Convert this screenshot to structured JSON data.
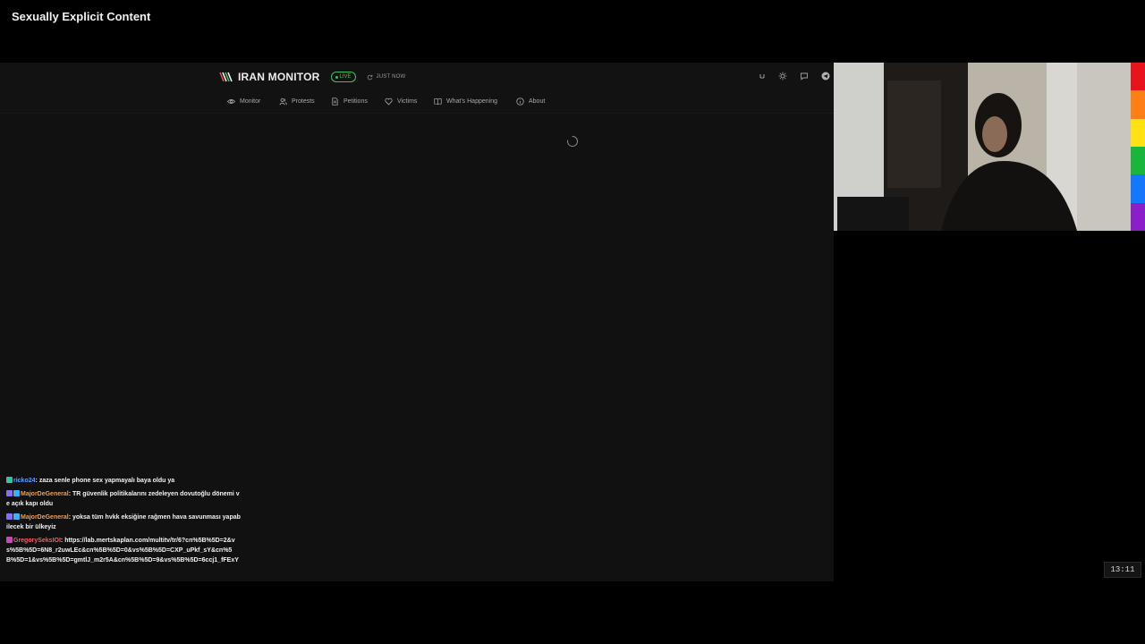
{
  "overlay": {
    "label": "Sexually Explicit Content"
  },
  "header": {
    "brand": "IRAN MONITOR",
    "live_badge": "LIVE",
    "update_status": "JUST NOW",
    "icons": [
      {
        "name": "language-toggle-icon",
        "glyph": "ı"
      },
      {
        "name": "theme-toggle-icon",
        "glyph": "sun"
      },
      {
        "name": "chat-icon",
        "glyph": "chat"
      },
      {
        "name": "telegram-icon",
        "glyph": "telegram"
      }
    ]
  },
  "nav": {
    "items": [
      {
        "label": "Monitor",
        "icon": "eye-icon"
      },
      {
        "label": "Protests",
        "icon": "people-icon"
      },
      {
        "label": "Petitions",
        "icon": "document-icon"
      },
      {
        "label": "Victims",
        "icon": "heart-icon"
      },
      {
        "label": "What's Happening",
        "icon": "book-icon"
      },
      {
        "label": "About",
        "icon": "info-icon"
      }
    ]
  },
  "main": {
    "state": "loading",
    "spinner_icon": "loading-spinner-icon"
  },
  "chat": {
    "messages": [
      {
        "user": "ricko24",
        "user_color": "#5aa0ff",
        "badges": [
          "#2ec4a8"
        ],
        "text": "zaza senle phone sex yapmayalı baya oldu ya"
      },
      {
        "user": "MajorDeGeneral",
        "user_color": "#ff9a3c",
        "badges": [
          "#8a6cff",
          "#3cb0ff"
        ],
        "text": "TR güvenlik politikalarını zedeleyen dovutoğlu dönemi ve açık kapı oldu"
      },
      {
        "user": "MajorDeGeneral",
        "user_color": "#ff9a3c",
        "badges": [
          "#8a6cff",
          "#3cb0ff"
        ],
        "text": "yoksa tüm hvkk eksiğine rağmen hava savunması yapabilecek bir ülkeyiz"
      },
      {
        "user": "GregorySeksIOI",
        "user_color": "#ff5a5a",
        "badges": [
          "#c84ab0"
        ],
        "text": "https://lab.mertskaplan.com/multitv/tr/6?cn%5B%5D=2&vs%5B%5D=6N8_r2uwLEc&cn%5B%5D=0&vs%5B%5D=CXP_uPkf_sY&cn%5B%5D=1&vs%5B%5D=gmtlJ_m2r5A&cn%5B%5D=9&vs%5B%5D=6ccj1_fFExY"
      }
    ]
  },
  "clock": "13:11",
  "colors": {
    "live": "#3fbf5a",
    "background": "#111111",
    "rainbow": [
      "#e8141b",
      "#ff7f17",
      "#ffe213",
      "#1bb53c",
      "#1478ff",
      "#8a1ec8"
    ]
  }
}
